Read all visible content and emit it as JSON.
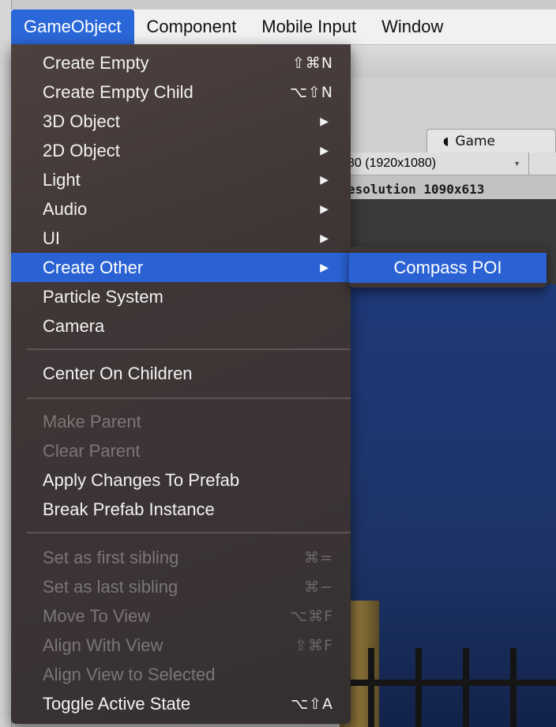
{
  "menubar": {
    "items": [
      "GameObject",
      "Component",
      "Mobile Input",
      "Window"
    ],
    "active": "GameObject"
  },
  "game_tab": {
    "label": "Game",
    "icon": "pacman-icon"
  },
  "resolution": {
    "dropdown": "80 (1920x1080)",
    "stats": "esolution 1090x613"
  },
  "menu": {
    "create_empty": {
      "label": "Create Empty",
      "shortcut": "⇧⌘N"
    },
    "create_empty_child": {
      "label": "Create Empty Child",
      "shortcut": "⌥⇧N"
    },
    "object_3d": {
      "label": "3D Object"
    },
    "object_2d": {
      "label": "2D Object"
    },
    "light": {
      "label": "Light"
    },
    "audio": {
      "label": "Audio"
    },
    "ui": {
      "label": "UI"
    },
    "create_other": {
      "label": "Create Other"
    },
    "particle_system": {
      "label": "Particle System"
    },
    "camera": {
      "label": "Camera"
    },
    "center_on_children": {
      "label": "Center On Children"
    },
    "make_parent": {
      "label": "Make Parent"
    },
    "clear_parent": {
      "label": "Clear Parent"
    },
    "apply_changes": {
      "label": "Apply Changes To Prefab"
    },
    "break_prefab": {
      "label": "Break Prefab Instance"
    },
    "set_first_sibling": {
      "label": "Set as first sibling",
      "shortcut": "⌘="
    },
    "set_last_sibling": {
      "label": "Set as last sibling",
      "shortcut": "⌘−"
    },
    "move_to_view": {
      "label": "Move To View",
      "shortcut": "⌥⌘F"
    },
    "align_with_view": {
      "label": "Align With View",
      "shortcut": "⇧⌘F"
    },
    "align_view_to_selected": {
      "label": "Align View to Selected"
    },
    "toggle_active": {
      "label": "Toggle Active State",
      "shortcut": "⌥⇧A"
    },
    "submenu_arrow": "▶"
  },
  "submenu": {
    "compass_poi": "Compass POI"
  },
  "colors": {
    "highlight": "#2a62d4",
    "menu_bg": "#3f3636",
    "disabled_text": "#7b7676"
  }
}
